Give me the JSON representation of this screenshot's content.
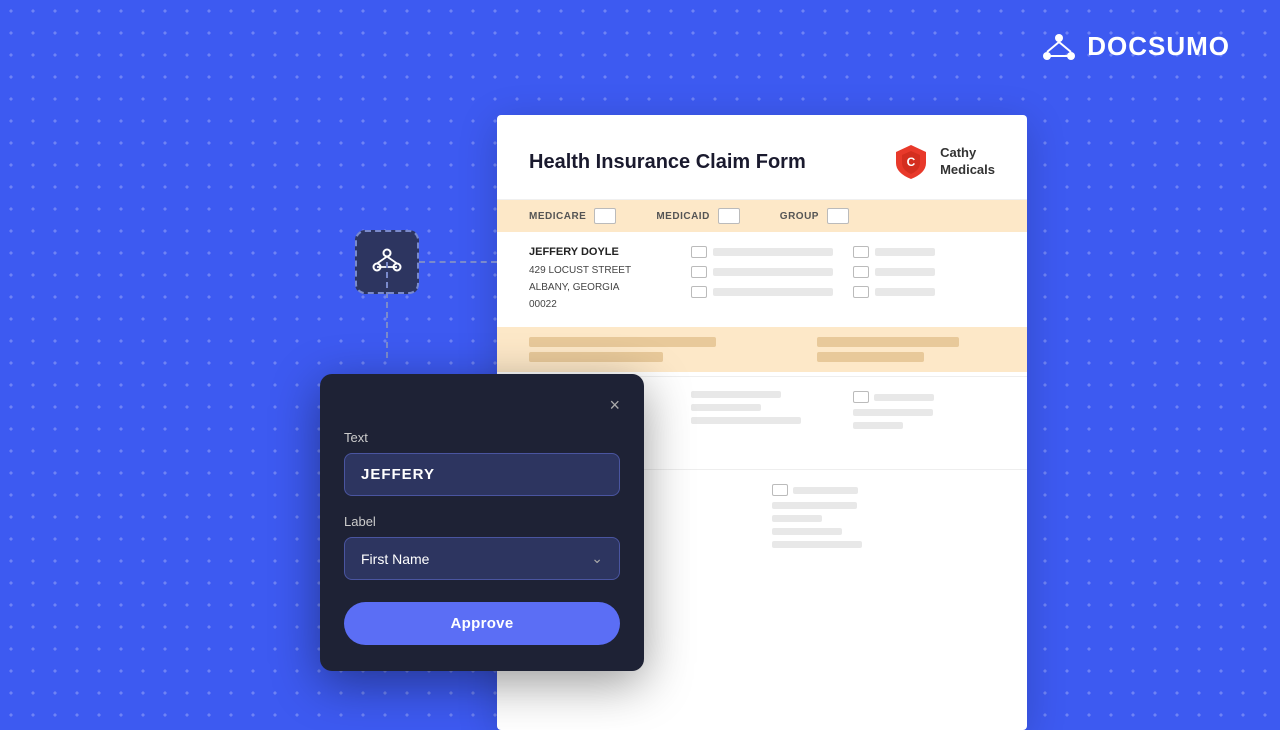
{
  "app": {
    "name": "DocSumo",
    "logo_icon": "network-icon"
  },
  "document": {
    "title": "Health Insurance Claim Form",
    "brand_name": "Cathy\nMedicals",
    "insurance_types": [
      {
        "label": "MEDICARE"
      },
      {
        "label": "MEDICAID"
      },
      {
        "label": "GROUP"
      }
    ],
    "patient": {
      "name": "JEFFERY DOYLE",
      "address_line1": "429 LOCUST STREET",
      "address_line2": "ALBANY, GEORGIA",
      "zip": "00022"
    }
  },
  "annotation_node": {
    "icon": "⎇"
  },
  "modal": {
    "text_label": "Text",
    "text_value": "JEFFERY",
    "label_label": "Label",
    "label_value": "First Name",
    "close_icon": "×",
    "approve_button": "Approve",
    "chevron": "⌄"
  }
}
